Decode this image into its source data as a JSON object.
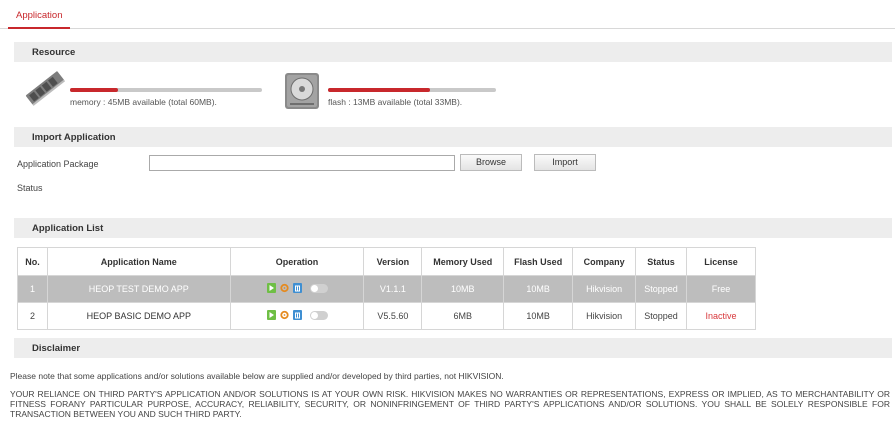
{
  "tab": {
    "label": "Application"
  },
  "resource": {
    "header": "Resource",
    "memory": {
      "icon": "memory-stick-icon",
      "text": "memory : 45MB available (total 60MB).",
      "used_fraction": 0.25
    },
    "flash": {
      "icon": "hard-disk-icon",
      "text": "flash : 13MB available (total 33MB).",
      "used_fraction": 0.61
    }
  },
  "import": {
    "header": "Import Application",
    "package_label": "Application Package",
    "package_value": "",
    "browse_label": "Browse",
    "import_label": "Import",
    "status_label": "Status"
  },
  "app_list": {
    "header": "Application List",
    "columns": [
      "No.",
      "Application Name",
      "Operation",
      "Version",
      "Memory Used",
      "Flash Used",
      "Company",
      "Status",
      "License"
    ],
    "rows": [
      {
        "no": "1",
        "name": "HEOP TEST DEMO APP",
        "version": "V1.1.1",
        "memory": "10MB",
        "flash": "10MB",
        "company": "Hikvision",
        "status": "Stopped",
        "license": "Free",
        "license_color": "#ffffff"
      },
      {
        "no": "2",
        "name": "HEOP BASIC DEMO APP",
        "version": "V5.5.60",
        "memory": "6MB",
        "flash": "10MB",
        "company": "Hikvision",
        "status": "Stopped",
        "license": "Inactive",
        "license_color": "#d8383c"
      }
    ],
    "operation_icons": [
      "start-icon",
      "settings-icon",
      "delete-icon",
      "toggle-switch"
    ]
  },
  "disclaimer": {
    "header": "Disclaimer",
    "line1": "Please note that some applications and/or solutions available below are supplied and/or developed by third parties, not HIKVISION.",
    "paragraph": "YOUR RELIANCE ON THIRD PARTY'S APPLICATION AND/OR SOLUTIONS IS AT YOUR OWN RISK. HIKVISION MAKES NO WARRANTIES OR REPRESENTATIONS, EXPRESS OR IMPLIED, AS TO MERCHANTABILITY OR FITNESS FORANY PARTICULAR PURPOSE, ACCURACY, RELIABILITY, SECURITY, OR NONINFRINGEMENT OF THIRD PARTY'S APPLICATIONS AND/OR SOLUTIONS. YOU SHALL BE SOLELY RESPONSIBLE FOR TRANSACTION BETWEEN YOU AND SUCH THIRD PARTY."
  },
  "colors": {
    "accent": "#c8282c",
    "selected_row": "#bdbdbd",
    "section_bg": "#ededed"
  }
}
